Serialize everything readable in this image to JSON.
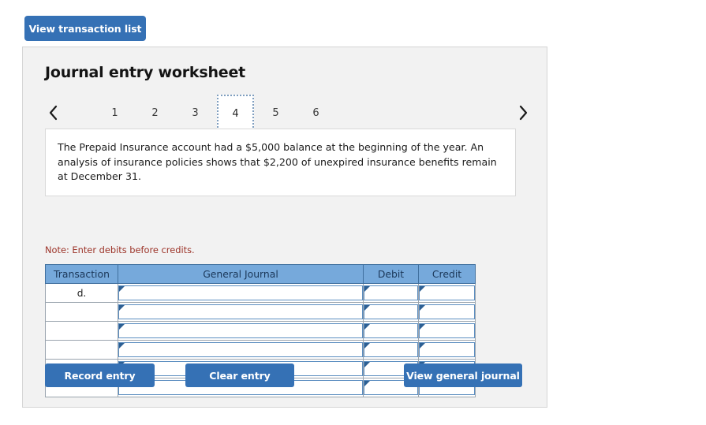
{
  "top": {
    "view_transaction_list_label": "View transaction list"
  },
  "panel": {
    "title": "Journal entry worksheet",
    "nav": {
      "prev_icon": "chevron-left-icon",
      "next_icon": "chevron-right-icon"
    },
    "tabs": [
      {
        "label": "1",
        "active": false
      },
      {
        "label": "2",
        "active": false
      },
      {
        "label": "3",
        "active": false
      },
      {
        "label": "4",
        "active": true
      },
      {
        "label": "5",
        "active": false
      },
      {
        "label": "6",
        "active": false
      }
    ],
    "description": "The Prepaid Insurance account had a $5,000 balance at the beginning of the year. An analysis of insurance policies shows that $2,200 of unexpired insurance benefits remain at December 31.",
    "note": "Note: Enter debits before credits.",
    "table": {
      "headers": [
        "Transaction",
        "General Journal",
        "Debit",
        "Credit"
      ],
      "rows": [
        {
          "transaction": "d.",
          "general_journal": "",
          "debit": "",
          "credit": ""
        },
        {
          "transaction": "",
          "general_journal": "",
          "debit": "",
          "credit": ""
        },
        {
          "transaction": "",
          "general_journal": "",
          "debit": "",
          "credit": ""
        },
        {
          "transaction": "",
          "general_journal": "",
          "debit": "",
          "credit": ""
        },
        {
          "transaction": "",
          "general_journal": "",
          "debit": "",
          "credit": ""
        },
        {
          "transaction": "",
          "general_journal": "",
          "debit": "",
          "credit": ""
        }
      ]
    },
    "buttons": {
      "record_entry": "Record entry",
      "clear_entry": "Clear entry",
      "view_general_journal": "View general journal"
    }
  },
  "colors": {
    "button_blue": "#3571b5",
    "table_header_blue": "#76a9db",
    "note_red": "#9c3328",
    "panel_bg": "#f2f2f2"
  }
}
